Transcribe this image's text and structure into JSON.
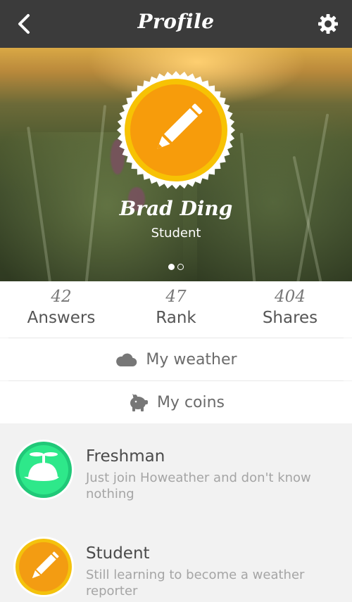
{
  "header": {
    "title": "Profile",
    "back_icon": "chevron-left-icon",
    "settings_icon": "gear-icon"
  },
  "profile": {
    "name": "Brad Ding",
    "role": "Student",
    "badge_icon": "pencil-icon",
    "badge_color": "#f39c12",
    "page_indicator": {
      "count": 2,
      "active": 0
    }
  },
  "stats": [
    {
      "value": "42",
      "label": "Answers"
    },
    {
      "value": "47",
      "label": "Rank"
    },
    {
      "value": "404",
      "label": "Shares"
    }
  ],
  "menu": [
    {
      "label": "My weather",
      "icon": "cloud-icon"
    },
    {
      "label": "My coins",
      "icon": "piggy-bank-icon"
    }
  ],
  "achievements": [
    {
      "title": "Freshman",
      "description": "Just join Howeather and don't know nothing",
      "icon": "propeller-cap-icon",
      "color": "#2ee88a"
    },
    {
      "title": "Student",
      "description": "Still learning to become a weather reporter",
      "icon": "pencil-icon",
      "color": "#f39c12"
    }
  ]
}
